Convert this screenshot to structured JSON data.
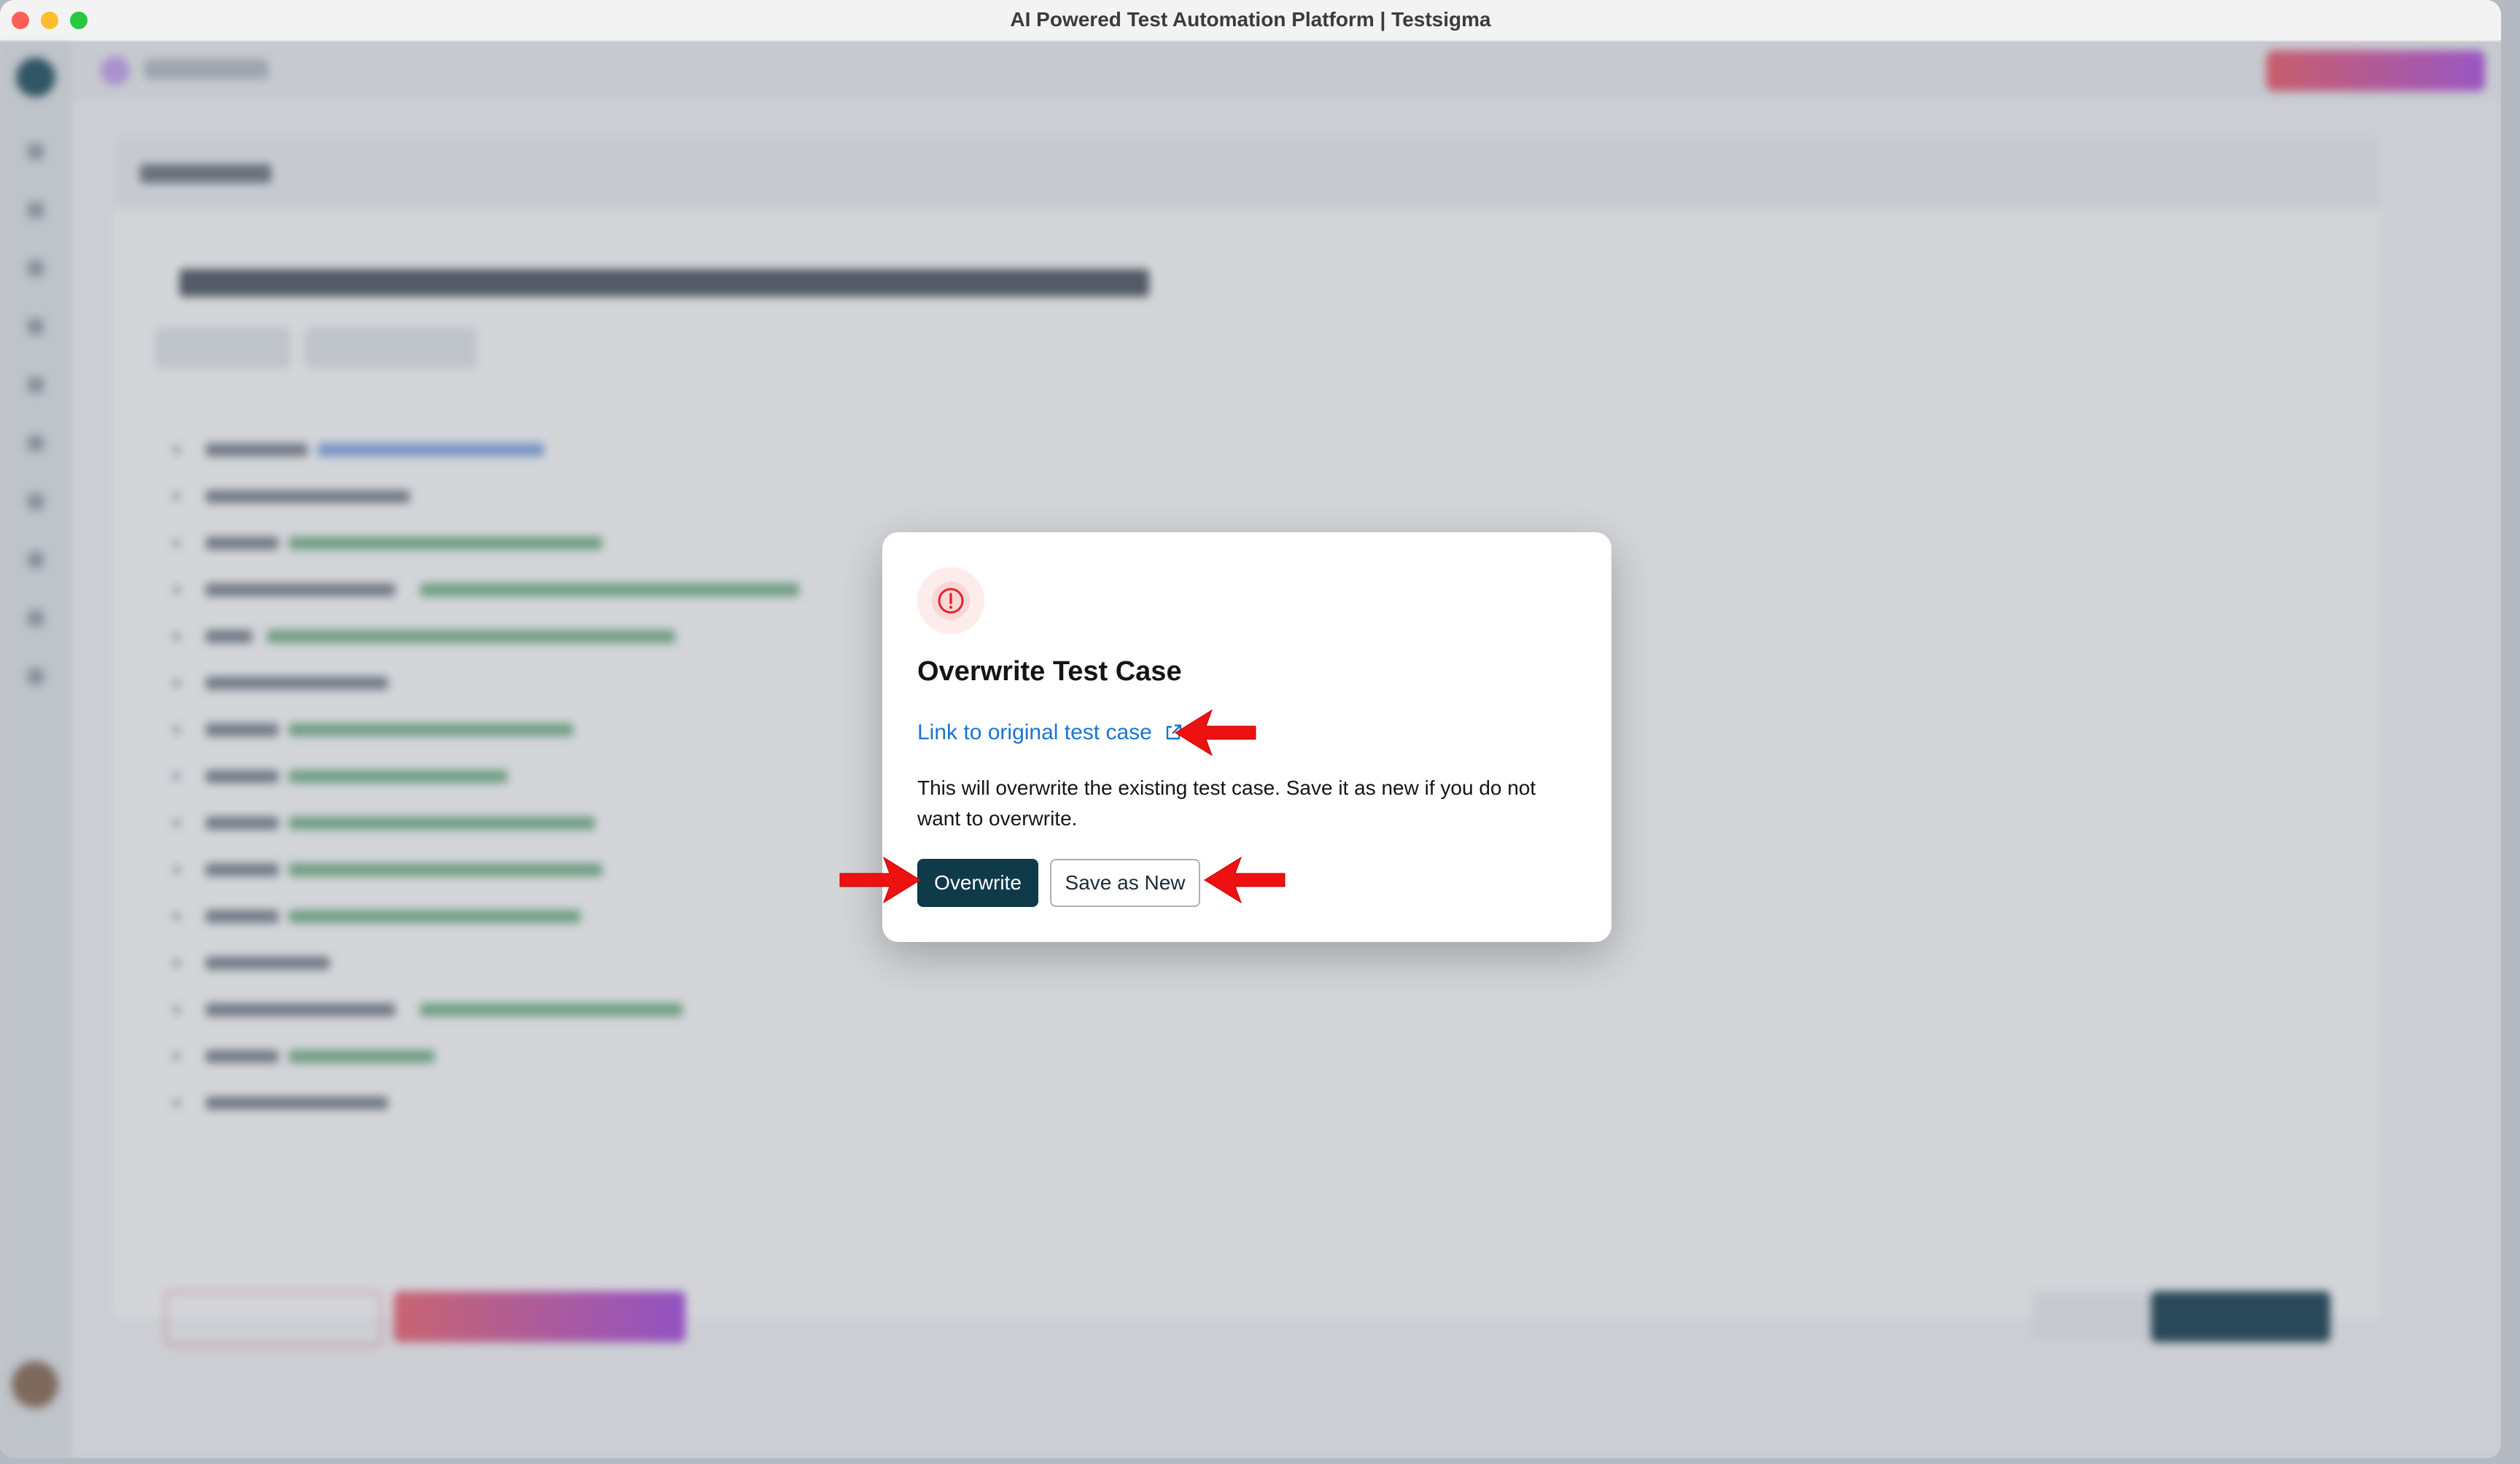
{
  "window": {
    "title": "AI Powered Test Automation Platform | Testsigma"
  },
  "dialog": {
    "title": "Overwrite Test Case",
    "link_label": "Link to original test case",
    "message": "This will overwrite the existing test case. Save it as new if you do not want to overwrite.",
    "primary_label": "Overwrite",
    "secondary_label": "Save as New"
  },
  "icons": {
    "warning": "exclamation-circle-icon",
    "link": "external-link-icon",
    "annotation": "red-arrow-icon"
  },
  "colors": {
    "primary_button": "#0e3a4a",
    "link": "#1b74d0",
    "warning": "#e5242b",
    "annotation_arrow": "#ee1111"
  }
}
